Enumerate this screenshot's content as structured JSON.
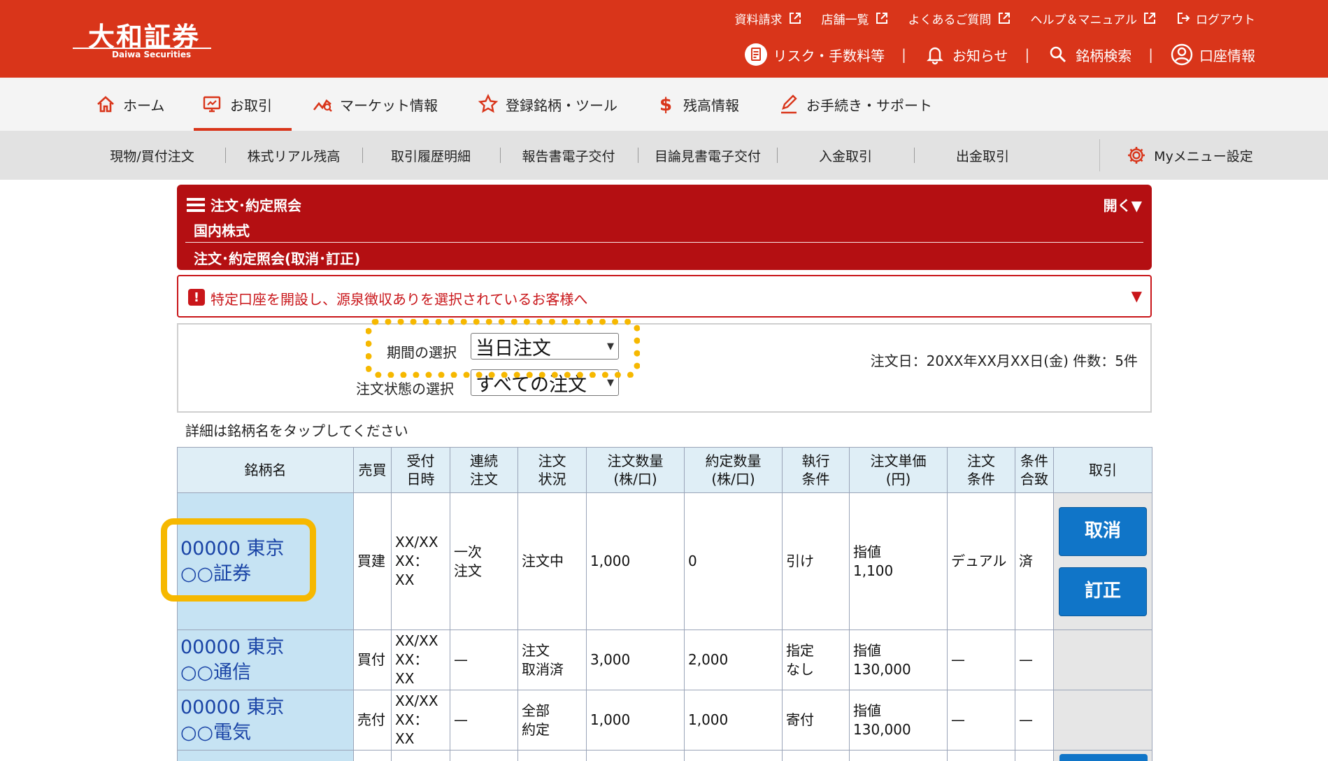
{
  "brand": {
    "name": "大和証券",
    "sub": "Daiwa Securities"
  },
  "utility_links": [
    {
      "label": "資料請求"
    },
    {
      "label": "店舗一覧"
    },
    {
      "label": "よくあるご質問"
    },
    {
      "label": "ヘルプ＆マニュアル"
    },
    {
      "label": "ログアウト"
    }
  ],
  "main_utility": [
    {
      "label": "リスク・手数料等",
      "icon": "document-icon"
    },
    {
      "label": "お知らせ",
      "icon": "bell-icon"
    },
    {
      "label": "銘柄検索",
      "icon": "search-icon"
    },
    {
      "label": "口座情報",
      "icon": "account-icon"
    }
  ],
  "global_nav": [
    {
      "label": "ホーム",
      "icon": "home-icon"
    },
    {
      "label": "お取引",
      "icon": "trade-screen-icon",
      "active": true
    },
    {
      "label": "マーケット情報",
      "icon": "market-chart-icon"
    },
    {
      "label": "登録銘柄・ツール",
      "icon": "star-icon"
    },
    {
      "label": "残高情報",
      "icon": "dollar-icon"
    },
    {
      "label": "お手続き・サポート",
      "icon": "pencil-icon"
    }
  ],
  "sub_nav": [
    {
      "label": "現物/買付注文"
    },
    {
      "label": "株式リアル残高"
    },
    {
      "label": "取引履歴明細"
    },
    {
      "label": "報告書電子交付"
    },
    {
      "label": "目論見書電子交付"
    },
    {
      "label": "入金取引"
    },
    {
      "label": "出金取引"
    }
  ],
  "my_menu": {
    "label": "Myメニュー設定",
    "icon": "gear-icon"
  },
  "page_header": {
    "title": "注文･約定照会",
    "category": "国内株式",
    "subtitle": "注文･約定照会(取消･訂正)",
    "toggle": "開く▼"
  },
  "alert": {
    "icon": "!",
    "text": "特定口座を開設し、源泉徴収ありを選択されているお客様へ",
    "caret": "▼"
  },
  "filters": {
    "period_label": "期間の選択",
    "period_value": "当日注文",
    "status_label": "注文状態の選択",
    "status_value": "すべての注文",
    "summary": "注文日：20XX年XX月XX日(金)  件数：5件"
  },
  "hint": "詳細は銘柄名をタップしてください",
  "table": {
    "headers": [
      {
        "l1": "銘柄名",
        "l2": ""
      },
      {
        "l1": "売買",
        "l2": ""
      },
      {
        "l1": "受付",
        "l2": "日時"
      },
      {
        "l1": "連続",
        "l2": "注文"
      },
      {
        "l1": "注文",
        "l2": "状況"
      },
      {
        "l1": "注文数量",
        "l2": "(株/口)"
      },
      {
        "l1": "約定数量",
        "l2": "(株/口)"
      },
      {
        "l1": "執行",
        "l2": "条件"
      },
      {
        "l1": "注文単価",
        "l2": "(円)"
      },
      {
        "l1": "注文",
        "l2": "条件"
      },
      {
        "l1": "条件",
        "l2": "合致"
      },
      {
        "l1": "取引",
        "l2": ""
      }
    ],
    "rows": [
      {
        "name1": "00000 東京",
        "name2": "○○証券",
        "side": "買建",
        "recv1": "XX/XX",
        "recv2": "XX：XX",
        "cont1": "一次",
        "cont2": "注文",
        "stat1": "注文中",
        "stat2": "",
        "qty": "1,000",
        "filled": "0",
        "exec1": "引け",
        "exec2": "",
        "price1": "指値",
        "price2": "1,100",
        "cond": "デュアル",
        "match": "済",
        "cancel": "取消",
        "modify": "訂正"
      },
      {
        "name1": "00000 東京",
        "name2": "○○通信",
        "side": "買付",
        "recv1": "XX/XX",
        "recv2": "XX：XX",
        "cont1": "—",
        "cont2": "",
        "stat1": "注文",
        "stat2": "取消済",
        "qty": "3,000",
        "filled": "2,000",
        "exec1": "指定",
        "exec2": "なし",
        "price1": "指値",
        "price2": "130,000",
        "cond": "—",
        "match": "—"
      },
      {
        "name1": "00000 東京",
        "name2": "○○電気",
        "side": "売付",
        "recv1": "XX/XX",
        "recv2": "XX：XX",
        "cont1": "—",
        "cont2": "",
        "stat1": "全部",
        "stat2": "約定",
        "qty": "1,000",
        "filled": "1,000",
        "exec1": "寄付",
        "exec2": "",
        "price1": "指値",
        "price2": "130,000",
        "cond": "—",
        "match": "—"
      }
    ]
  }
}
